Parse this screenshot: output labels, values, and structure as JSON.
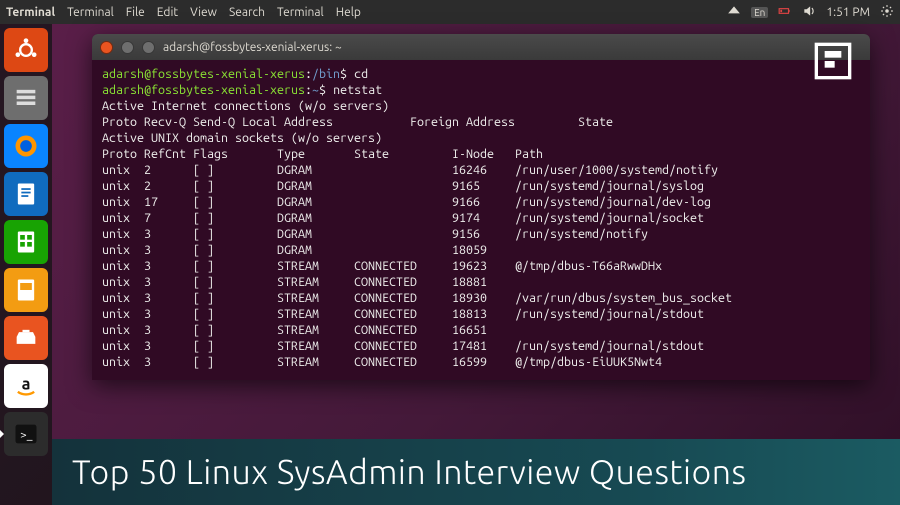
{
  "topbar": {
    "app": "Terminal",
    "menus": [
      "Terminal",
      "File",
      "Edit",
      "View",
      "Search",
      "Terminal",
      "Help"
    ],
    "lang": "En",
    "time": "1:51 PM"
  },
  "launcher_labels": [
    "ubuntu-dash",
    "files",
    "firefox",
    "writer",
    "calc",
    "impress",
    "software-center",
    "amazon",
    "terminal"
  ],
  "terminal": {
    "title": "adarsh@fossbytes-xenial-xerus: ~",
    "prompt_user_host": "adarsh@fossbytes-xenial-xerus",
    "prompt_path_bin": "/bin",
    "prompt_path_home": "~",
    "cmd1": "cd",
    "cmd2": "netstat",
    "header_net": "Active Internet connections (w/o servers)",
    "header_cols_net": "Proto Recv-Q Send-Q Local Address           Foreign Address         State",
    "header_unix": "Active UNIX domain sockets (w/o servers)",
    "header_cols_unix": "Proto RefCnt Flags       Type       State         I-Node   Path",
    "rows": [
      "unix  2      [ ]         DGRAM                    16246    /run/user/1000/systemd/notify",
      "unix  2      [ ]         DGRAM                    9165     /run/systemd/journal/syslog",
      "unix  17     [ ]         DGRAM                    9166     /run/systemd/journal/dev-log",
      "unix  7      [ ]         DGRAM                    9174     /run/systemd/journal/socket",
      "unix  3      [ ]         DGRAM                    9156     /run/systemd/notify",
      "unix  3      [ ]         DGRAM                    18059    ",
      "unix  3      [ ]         STREAM     CONNECTED     19623    @/tmp/dbus-T66aRwwDHx",
      "unix  3      [ ]         STREAM     CONNECTED     18881    ",
      "unix  3      [ ]         STREAM     CONNECTED     18930    /var/run/dbus/system_bus_socket",
      "unix  3      [ ]         STREAM     CONNECTED     18813    /run/systemd/journal/stdout",
      "unix  3      [ ]         STREAM     CONNECTED     16651    ",
      "unix  3      [ ]         STREAM     CONNECTED     17481    /run/systemd/journal/stdout",
      "unix  3      [ ]         STREAM     CONNECTED     16599    @/tmp/dbus-EiUUK5Nwt4"
    ]
  },
  "banner": {
    "text": "Top 50 Linux SysAdmin Interview Questions"
  }
}
